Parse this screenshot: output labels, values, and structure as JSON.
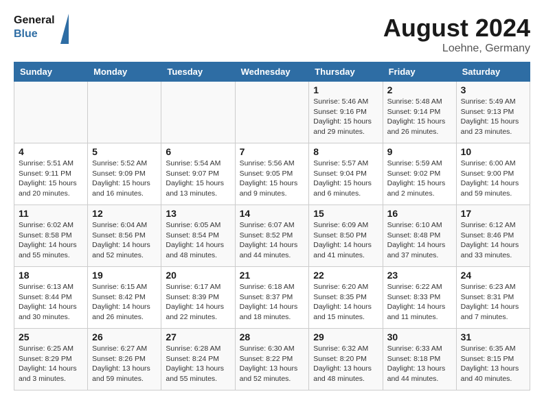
{
  "header": {
    "logo_line1": "General",
    "logo_line2": "Blue",
    "month_title": "August 2024",
    "location": "Loehne, Germany"
  },
  "days_of_week": [
    "Sunday",
    "Monday",
    "Tuesday",
    "Wednesday",
    "Thursday",
    "Friday",
    "Saturday"
  ],
  "weeks": [
    [
      {
        "day": "",
        "info": ""
      },
      {
        "day": "",
        "info": ""
      },
      {
        "day": "",
        "info": ""
      },
      {
        "day": "",
        "info": ""
      },
      {
        "day": "1",
        "info": "Sunrise: 5:46 AM\nSunset: 9:16 PM\nDaylight: 15 hours\nand 29 minutes."
      },
      {
        "day": "2",
        "info": "Sunrise: 5:48 AM\nSunset: 9:14 PM\nDaylight: 15 hours\nand 26 minutes."
      },
      {
        "day": "3",
        "info": "Sunrise: 5:49 AM\nSunset: 9:13 PM\nDaylight: 15 hours\nand 23 minutes."
      }
    ],
    [
      {
        "day": "4",
        "info": "Sunrise: 5:51 AM\nSunset: 9:11 PM\nDaylight: 15 hours\nand 20 minutes."
      },
      {
        "day": "5",
        "info": "Sunrise: 5:52 AM\nSunset: 9:09 PM\nDaylight: 15 hours\nand 16 minutes."
      },
      {
        "day": "6",
        "info": "Sunrise: 5:54 AM\nSunset: 9:07 PM\nDaylight: 15 hours\nand 13 minutes."
      },
      {
        "day": "7",
        "info": "Sunrise: 5:56 AM\nSunset: 9:05 PM\nDaylight: 15 hours\nand 9 minutes."
      },
      {
        "day": "8",
        "info": "Sunrise: 5:57 AM\nSunset: 9:04 PM\nDaylight: 15 hours\nand 6 minutes."
      },
      {
        "day": "9",
        "info": "Sunrise: 5:59 AM\nSunset: 9:02 PM\nDaylight: 15 hours\nand 2 minutes."
      },
      {
        "day": "10",
        "info": "Sunrise: 6:00 AM\nSunset: 9:00 PM\nDaylight: 14 hours\nand 59 minutes."
      }
    ],
    [
      {
        "day": "11",
        "info": "Sunrise: 6:02 AM\nSunset: 8:58 PM\nDaylight: 14 hours\nand 55 minutes."
      },
      {
        "day": "12",
        "info": "Sunrise: 6:04 AM\nSunset: 8:56 PM\nDaylight: 14 hours\nand 52 minutes."
      },
      {
        "day": "13",
        "info": "Sunrise: 6:05 AM\nSunset: 8:54 PM\nDaylight: 14 hours\nand 48 minutes."
      },
      {
        "day": "14",
        "info": "Sunrise: 6:07 AM\nSunset: 8:52 PM\nDaylight: 14 hours\nand 44 minutes."
      },
      {
        "day": "15",
        "info": "Sunrise: 6:09 AM\nSunset: 8:50 PM\nDaylight: 14 hours\nand 41 minutes."
      },
      {
        "day": "16",
        "info": "Sunrise: 6:10 AM\nSunset: 8:48 PM\nDaylight: 14 hours\nand 37 minutes."
      },
      {
        "day": "17",
        "info": "Sunrise: 6:12 AM\nSunset: 8:46 PM\nDaylight: 14 hours\nand 33 minutes."
      }
    ],
    [
      {
        "day": "18",
        "info": "Sunrise: 6:13 AM\nSunset: 8:44 PM\nDaylight: 14 hours\nand 30 minutes."
      },
      {
        "day": "19",
        "info": "Sunrise: 6:15 AM\nSunset: 8:42 PM\nDaylight: 14 hours\nand 26 minutes."
      },
      {
        "day": "20",
        "info": "Sunrise: 6:17 AM\nSunset: 8:39 PM\nDaylight: 14 hours\nand 22 minutes."
      },
      {
        "day": "21",
        "info": "Sunrise: 6:18 AM\nSunset: 8:37 PM\nDaylight: 14 hours\nand 18 minutes."
      },
      {
        "day": "22",
        "info": "Sunrise: 6:20 AM\nSunset: 8:35 PM\nDaylight: 14 hours\nand 15 minutes."
      },
      {
        "day": "23",
        "info": "Sunrise: 6:22 AM\nSunset: 8:33 PM\nDaylight: 14 hours\nand 11 minutes."
      },
      {
        "day": "24",
        "info": "Sunrise: 6:23 AM\nSunset: 8:31 PM\nDaylight: 14 hours\nand 7 minutes."
      }
    ],
    [
      {
        "day": "25",
        "info": "Sunrise: 6:25 AM\nSunset: 8:29 PM\nDaylight: 14 hours\nand 3 minutes."
      },
      {
        "day": "26",
        "info": "Sunrise: 6:27 AM\nSunset: 8:26 PM\nDaylight: 13 hours\nand 59 minutes."
      },
      {
        "day": "27",
        "info": "Sunrise: 6:28 AM\nSunset: 8:24 PM\nDaylight: 13 hours\nand 55 minutes."
      },
      {
        "day": "28",
        "info": "Sunrise: 6:30 AM\nSunset: 8:22 PM\nDaylight: 13 hours\nand 52 minutes."
      },
      {
        "day": "29",
        "info": "Sunrise: 6:32 AM\nSunset: 8:20 PM\nDaylight: 13 hours\nand 48 minutes."
      },
      {
        "day": "30",
        "info": "Sunrise: 6:33 AM\nSunset: 8:18 PM\nDaylight: 13 hours\nand 44 minutes."
      },
      {
        "day": "31",
        "info": "Sunrise: 6:35 AM\nSunset: 8:15 PM\nDaylight: 13 hours\nand 40 minutes."
      }
    ]
  ]
}
